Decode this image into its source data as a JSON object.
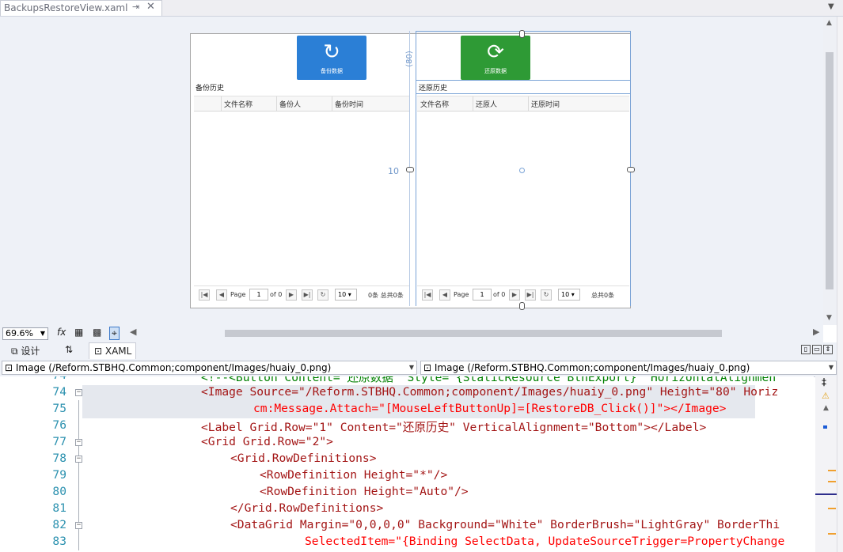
{
  "tab": {
    "title": "BackupsRestoreView.xaml",
    "pin": "⇥",
    "close": "✕"
  },
  "backup_panel": {
    "button_caption": "备份数据",
    "section_label": "备份历史",
    "columns": [
      "文件名称",
      "备份人",
      "备份时间"
    ],
    "pager": {
      "page_label": "Page",
      "page_value": "1",
      "of_label": "of 0",
      "size": "10",
      "summary": "0条 总共0条"
    }
  },
  "restore_panel": {
    "button_caption": "还原数据",
    "section_label": "还原历史",
    "columns": [
      "文件名称",
      "还原人",
      "还原时间"
    ],
    "pager": {
      "page_label": "Page",
      "page_value": "1",
      "of_label": "of 0",
      "size": "10",
      "summary": "总共0条"
    }
  },
  "adorners": {
    "row_height_label": "(80)",
    "column_margin_label": "10"
  },
  "colors": {
    "backup_button": "#2b7fd6",
    "restore_button": "#2e9a35"
  },
  "zoom": {
    "value": "69.6%"
  },
  "split_tabs": {
    "design": "设计",
    "swap": "⇅",
    "xaml": "XAML"
  },
  "nav": {
    "left": "Image (/Reform.STBHQ.Common;component/Images/huaiy_0.png)",
    "right": "Image (/Reform.STBHQ.Common;component/Images/huaiy_0.png)"
  },
  "code_lines": [
    {
      "num": "74",
      "pre": "<!--<Button Content=\"还原数据\" Style=\"{StaticResource BtnExport}\" HorizontalAlignmen"
    },
    {
      "num": "74",
      "text": "<Image Source=\"/Reform.STBHQ.Common;component/Images/huaiy_0.png\" Height=\"80\" Horiz"
    },
    {
      "num": "75",
      "text": "cm:Message.Attach=\"[MouseLeftButtonUp]=[RestoreDB_Click()]\"></Image>"
    },
    {
      "num": "76",
      "text": "<Label Grid.Row=\"1\" Content=\"还原历史\" VerticalAlignment=\"Bottom\"></Label>"
    },
    {
      "num": "77",
      "text": "<Grid Grid.Row=\"2\">"
    },
    {
      "num": "78",
      "text": "<Grid.RowDefinitions>"
    },
    {
      "num": "79",
      "text": "<RowDefinition Height=\"*\"/>"
    },
    {
      "num": "80",
      "text": "<RowDefinition Height=\"Auto\"/>"
    },
    {
      "num": "81",
      "text": "</Grid.RowDefinitions>"
    },
    {
      "num": "82",
      "text": "<DataGrid Margin=\"0,0,0,0\" Background=\"White\" BorderBrush=\"LightGray\" BorderThi"
    },
    {
      "num": "83",
      "text": "SelectedItem=\"{Binding SelectData, UpdateSourceTrigger=PropertyChange"
    }
  ]
}
